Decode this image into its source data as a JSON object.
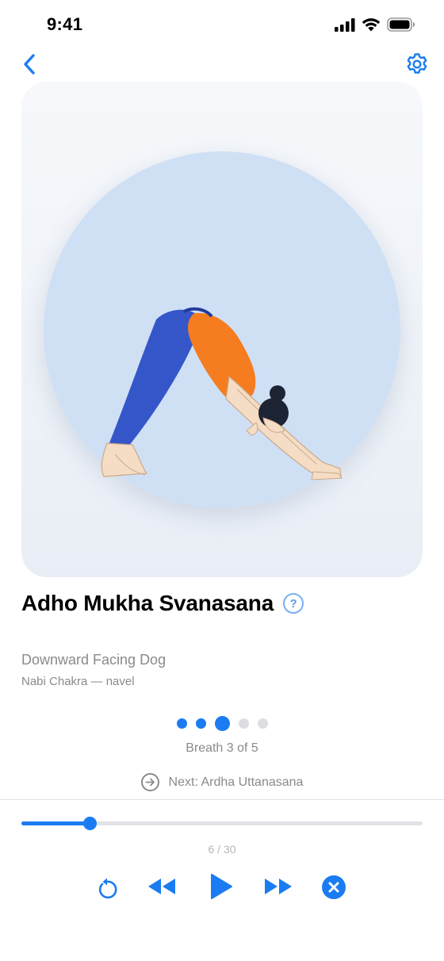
{
  "status_bar": {
    "time": "9:41"
  },
  "nav": {
    "back_icon": "chevron-left-icon",
    "settings_icon": "gear-icon"
  },
  "pose": {
    "sanskrit_name": "Adho Mukha Svanasana",
    "help_glyph": "?",
    "english_name": "Downward Facing Dog",
    "chakra": "Nabi Chakra — navel"
  },
  "breath": {
    "total": 5,
    "current": 3,
    "label": "Breath 3 of 5"
  },
  "next": {
    "label": "Next: Ardha Uttanasana"
  },
  "progress": {
    "current": 6,
    "total": 30,
    "label": "6 / 30",
    "fraction": 0.17
  },
  "colors": {
    "accent": "#1b7cf2",
    "muted_text": "#8a8a8e",
    "card_bg": "#eef2f8",
    "circle_bg": "#cfe0f5"
  },
  "controls": {
    "restart_icon": "restart-icon",
    "rewind_icon": "rewind-icon",
    "play_icon": "play-icon",
    "fast_forward_icon": "fast-forward-icon",
    "close_icon": "close-circle-icon"
  }
}
